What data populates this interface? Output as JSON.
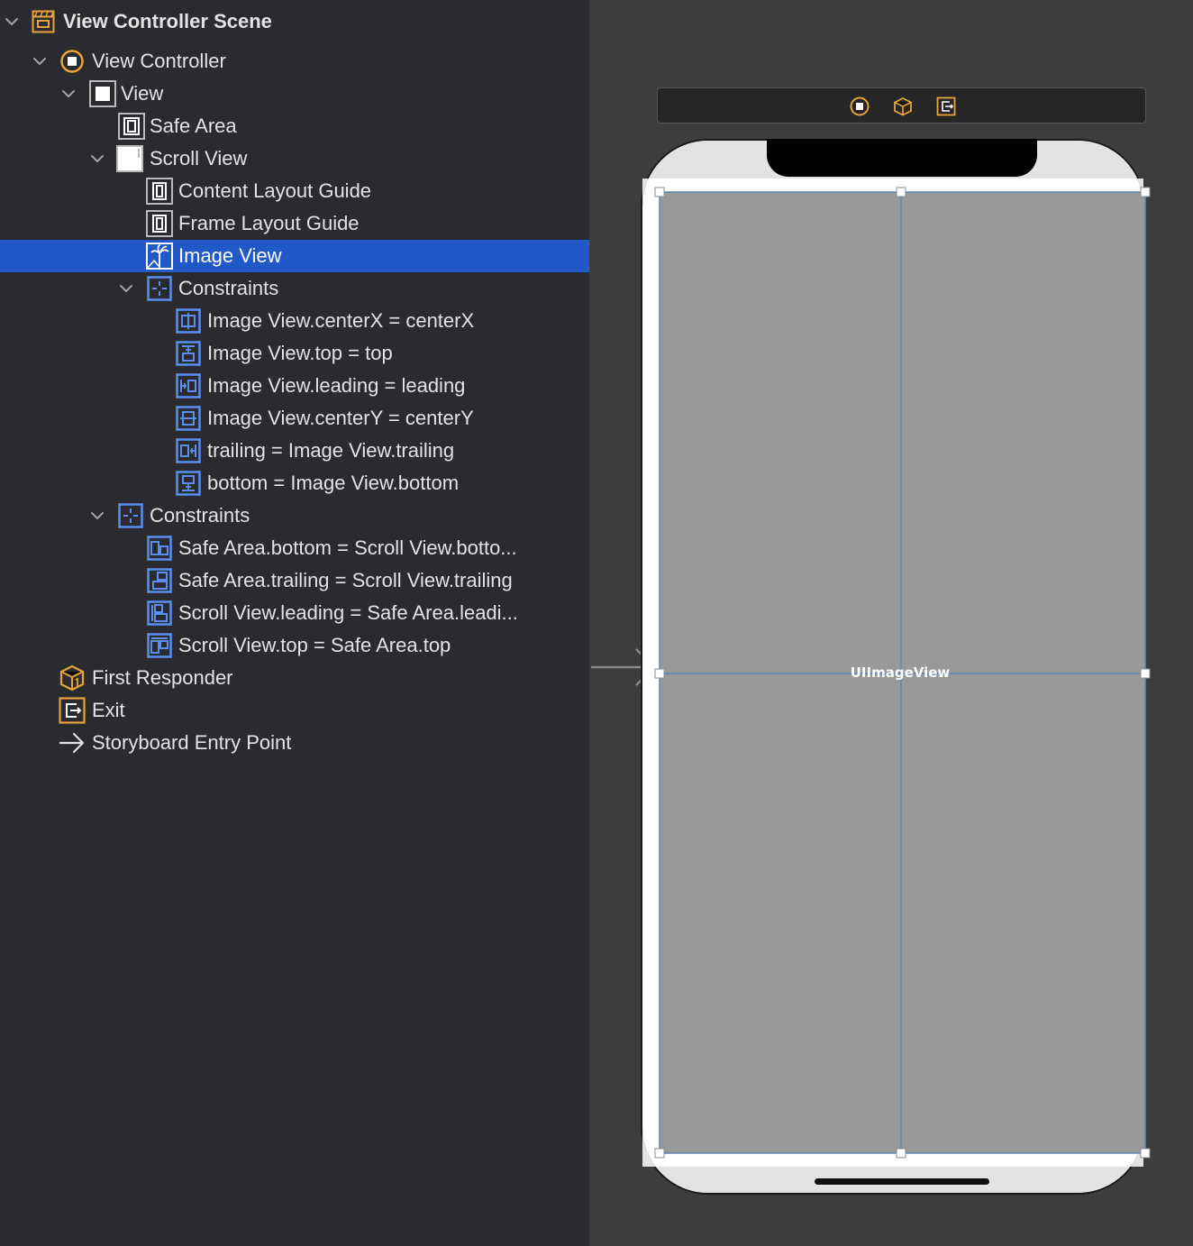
{
  "outline": {
    "items": [
      {
        "label": "View Controller Scene",
        "icon": "scene-icon",
        "disclosure": "expanded"
      },
      {
        "label": "View Controller",
        "icon": "view-controller-icon",
        "disclosure": "expanded"
      },
      {
        "label": "View",
        "icon": "view-icon",
        "disclosure": "expanded"
      },
      {
        "label": "Safe Area",
        "icon": "layout-guide-icon",
        "disclosure": "none"
      },
      {
        "label": "Scroll View",
        "icon": "scroll-view-icon",
        "disclosure": "expanded"
      },
      {
        "label": "Content Layout Guide",
        "icon": "layout-guide-icon",
        "disclosure": "none"
      },
      {
        "label": "Frame Layout Guide",
        "icon": "layout-guide-icon",
        "disclosure": "none"
      },
      {
        "label": "Image View",
        "icon": "image-view-icon",
        "disclosure": "none",
        "selected": true
      },
      {
        "label": "Constraints",
        "icon": "constraints-icon",
        "disclosure": "expanded"
      },
      {
        "label": "Image View.centerX = centerX",
        "icon": "constraint-center-x-icon",
        "disclosure": "none"
      },
      {
        "label": "Image View.top = top",
        "icon": "constraint-top-icon",
        "disclosure": "none"
      },
      {
        "label": "Image View.leading = leading",
        "icon": "constraint-leading-icon",
        "disclosure": "none"
      },
      {
        "label": "Image View.centerY = centerY",
        "icon": "constraint-center-y-icon",
        "disclosure": "none"
      },
      {
        "label": "trailing = Image View.trailing",
        "icon": "constraint-trailing-icon",
        "disclosure": "none"
      },
      {
        "label": "bottom = Image View.bottom",
        "icon": "constraint-bottom-icon",
        "disclosure": "none"
      },
      {
        "label": "Constraints",
        "icon": "constraints-icon",
        "disclosure": "expanded"
      },
      {
        "label": "Safe Area.bottom = Scroll View.botto...",
        "icon": "constraint-bottom-icon",
        "disclosure": "none"
      },
      {
        "label": "Safe Area.trailing = Scroll View.trailing",
        "icon": "constraint-trailing-icon",
        "disclosure": "none"
      },
      {
        "label": "Scroll View.leading = Safe Area.leadi...",
        "icon": "constraint-leading-icon",
        "disclosure": "none"
      },
      {
        "label": "Scroll View.top = Safe Area.top",
        "icon": "constraint-top-icon",
        "disclosure": "none"
      },
      {
        "label": "First Responder",
        "icon": "first-responder-icon",
        "disclosure": "none"
      },
      {
        "label": "Exit",
        "icon": "exit-icon",
        "disclosure": "none"
      },
      {
        "label": "Storyboard Entry Point",
        "icon": "arrow-right-icon",
        "disclosure": "none"
      }
    ]
  },
  "canvas": {
    "scene_dock_icons": [
      "view-controller-icon",
      "first-responder-icon",
      "exit-icon"
    ],
    "image_view_placeholder": "UIImageView"
  },
  "colors": {
    "outline_bg": "#2a2b2e",
    "selection": "#2259c9",
    "canvas_bg": "#3d3d3d",
    "accent_orange": "#e8a33b",
    "constraint_blue": "#5b8ef0",
    "image_view_fill": "#999999"
  }
}
